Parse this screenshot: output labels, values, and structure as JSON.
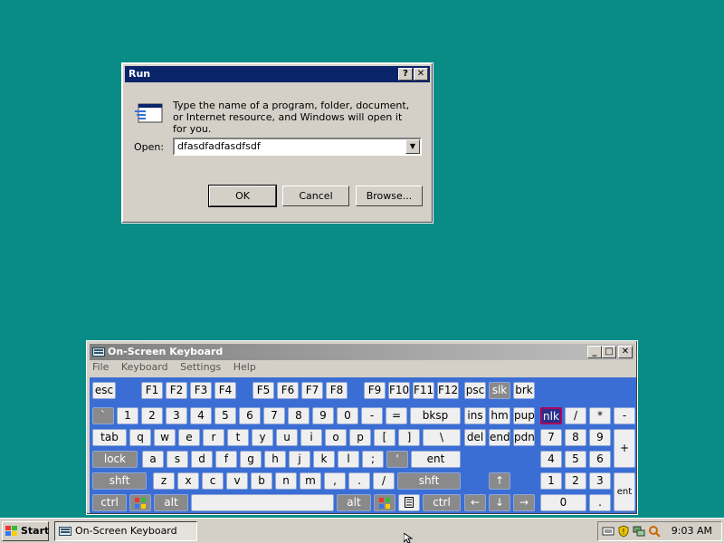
{
  "run_dialog": {
    "title": "Run",
    "help_label": "?",
    "close_label": "✕",
    "description": "Type the name of a program, folder, document, or Internet resource, and Windows will open it for you.",
    "open_label": "Open:",
    "open_value": "dfasdfadfasdfsdf",
    "ok_label": "OK",
    "cancel_label": "Cancel",
    "browse_label": "Browse..."
  },
  "osk": {
    "title": "On-Screen Keyboard",
    "menu": [
      "File",
      "Keyboard",
      "Settings",
      "Help"
    ],
    "keys": {
      "esc": "esc",
      "f1": "F1",
      "f2": "F2",
      "f3": "F3",
      "f4": "F4",
      "f5": "F5",
      "f6": "F6",
      "f7": "F7",
      "f8": "F8",
      "f9": "F9",
      "f10": "F10",
      "f11": "F11",
      "f12": "F12",
      "psc": "psc",
      "slk": "slk",
      "brk": "brk",
      "grave": "`",
      "k1": "1",
      "k2": "2",
      "k3": "3",
      "k4": "4",
      "k5": "5",
      "k6": "6",
      "k7": "7",
      "k8": "8",
      "k9": "9",
      "k0": "0",
      "minus": "-",
      "equals": "=",
      "bksp": "bksp",
      "ins": "ins",
      "hm": "hm",
      "pup": "pup",
      "nlk": "nlk",
      "div": "/",
      "mul": "*",
      "sub": "-",
      "tab": "tab",
      "q": "q",
      "w": "w",
      "e": "e",
      "r": "r",
      "t": "t",
      "y": "y",
      "u": "u",
      "i": "i",
      "o": "o",
      "p": "p",
      "lbr": "[",
      "rbr": "]",
      "bslash": "\\",
      "del": "del",
      "end": "end",
      "pdn": "pdn",
      "n7": "7",
      "n8": "8",
      "n9": "9",
      "add": "+",
      "lock": "lock",
      "a": "a",
      "s": "s",
      "d": "d",
      "f": "f",
      "g": "g",
      "h": "h",
      "j": "j",
      "k": "k",
      "l": "l",
      "semi": ";",
      "quote": "'",
      "ent": "ent",
      "n4": "4",
      "n5": "5",
      "n6": "6",
      "shft": "shft",
      "z": "z",
      "x": "x",
      "c": "c",
      "v": "v",
      "b": "b",
      "n": "n",
      "m": "m",
      "comma": ",",
      "period": ".",
      "slash": "/",
      "rshft": "shft",
      "up": "↑",
      "n1": "1",
      "n2": "2",
      "n3": "3",
      "nent": "ent",
      "ctrl": "ctrl",
      "alt": "alt",
      "ralt": "alt",
      "rctrl": "ctrl",
      "left": "←",
      "down": "↓",
      "right": "→",
      "n0": "0",
      "ndot": "."
    }
  },
  "taskbar": {
    "start_label": "Start",
    "task_label": "On-Screen Keyboard",
    "clock": "9:03 AM"
  }
}
